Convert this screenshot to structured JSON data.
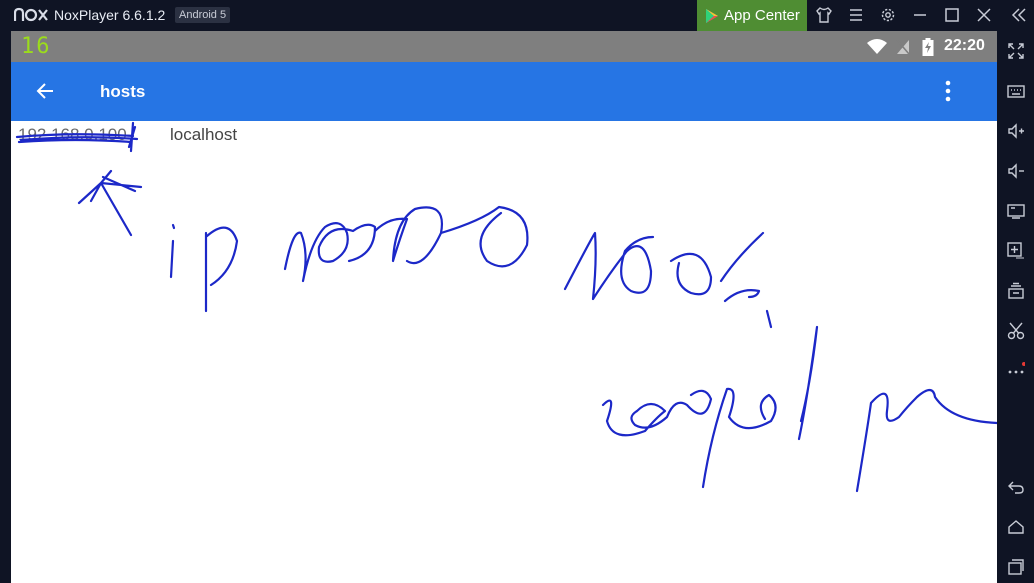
{
  "titlebar": {
    "app_name": "NoxPlayer 6.6.1.2",
    "android_version": "Android 5",
    "app_center_label": "App Center"
  },
  "statusbar": {
    "indicator": "16",
    "time": "22:20"
  },
  "appbar": {
    "title": "hosts"
  },
  "hosts_entry": {
    "ip": "192.168.0.100",
    "hostname": "localhost"
  },
  "colors": {
    "app_bar": "#2675e4",
    "status_bar": "#7f7f7f",
    "title_bar": "#0f1424",
    "app_center": "#4f8d33",
    "ink": "#1c28c8",
    "indicator": "#9bdc1c"
  },
  "sidebar_icons": [
    "fullscreen-icon",
    "keyboard-icon",
    "volume-up-icon",
    "volume-down-icon",
    "screen-icon",
    "apk-install-icon",
    "multi-instance-icon",
    "scissors-icon",
    "more-icon",
    "back-icon",
    "home-icon",
    "recents-icon"
  ]
}
